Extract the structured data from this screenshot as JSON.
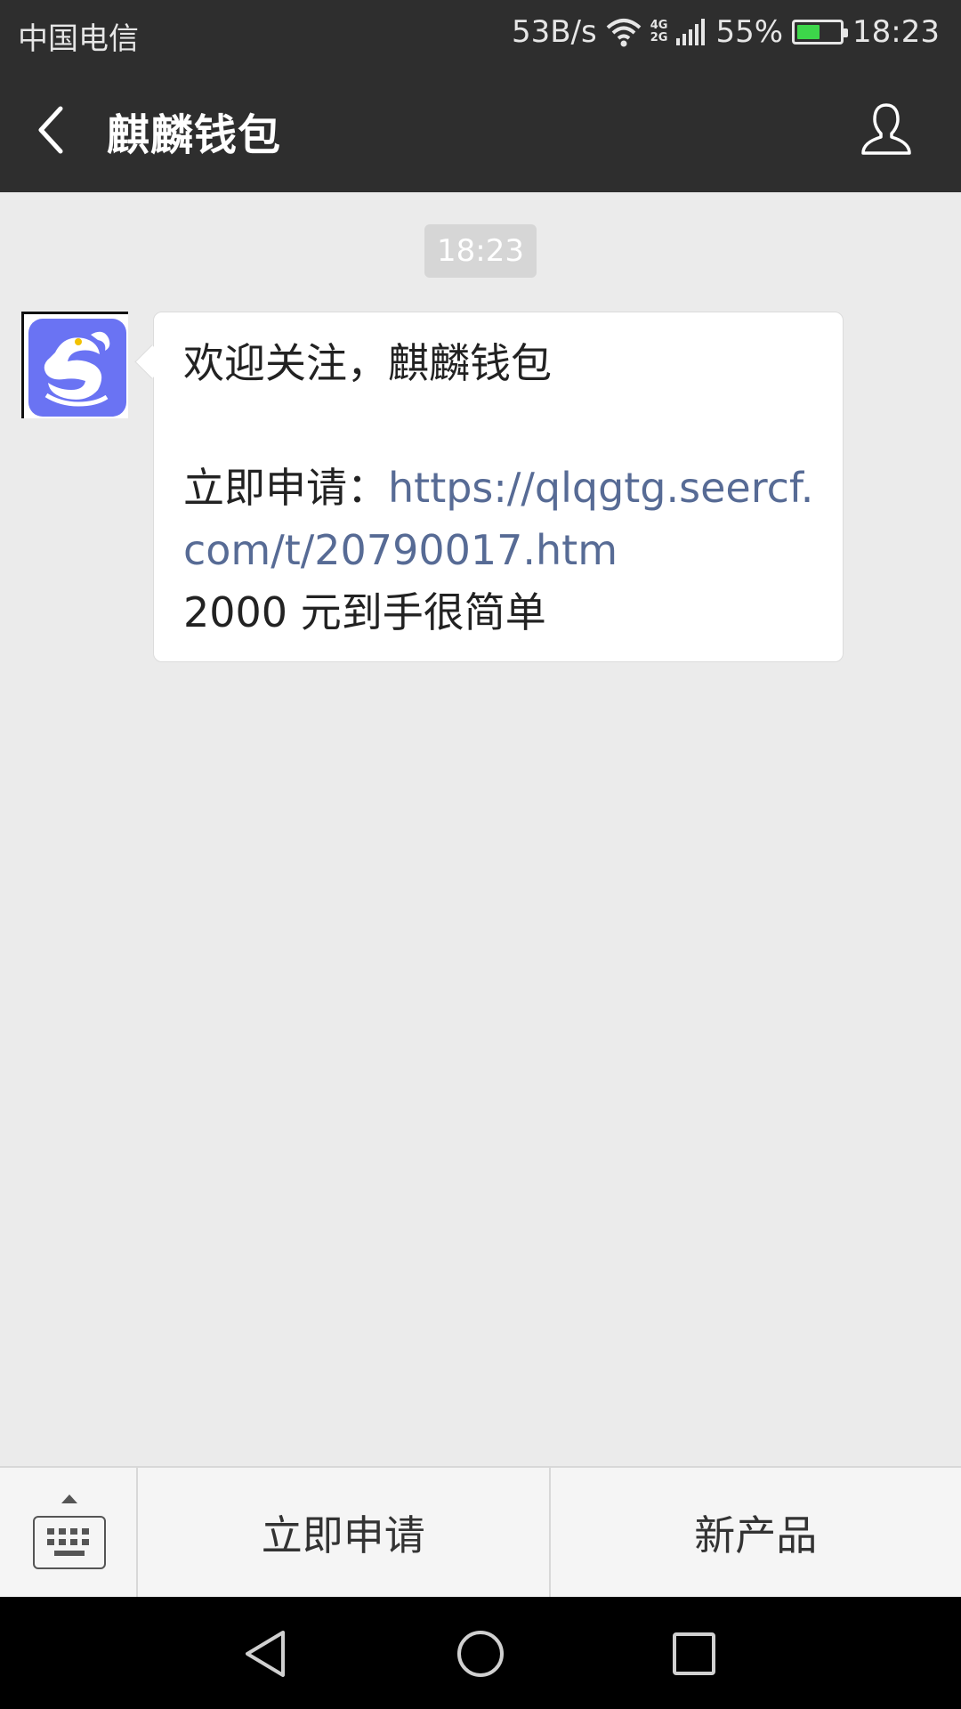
{
  "status_bar": {
    "carrier": "中国电信",
    "net_speed": "53B/s",
    "network_type": "4G\n2G",
    "battery_percent": "55%",
    "battery_level": 0.55,
    "time": "18:23",
    "icons": [
      "wifi-icon",
      "signal-icon",
      "battery-icon"
    ]
  },
  "nav": {
    "title": "麒麟钱包",
    "back_icon": "chevron-left-icon",
    "profile_icon": "person-icon"
  },
  "chat": {
    "timestamp": "18:23",
    "message": {
      "line1": "欢迎关注，麒麟钱包",
      "apply_prefix": "立即申请：",
      "link": "https://qlqgtg.seercf.com/t/20790017.htm",
      "line3": "2000 元到手很简单"
    }
  },
  "menu": {
    "keyboard_icon": "keyboard-icon",
    "items": [
      {
        "label": "立即申请"
      },
      {
        "label": "新产品"
      }
    ]
  },
  "system_nav": [
    "back-triangle-icon",
    "home-circle-icon",
    "recents-square-icon"
  ],
  "colors": {
    "header_bg": "#2e2e2e",
    "chat_bg": "#ebebeb",
    "link": "#576b95",
    "battery_fill": "#3dd64a",
    "avatar_bg": "#6a73f3"
  }
}
